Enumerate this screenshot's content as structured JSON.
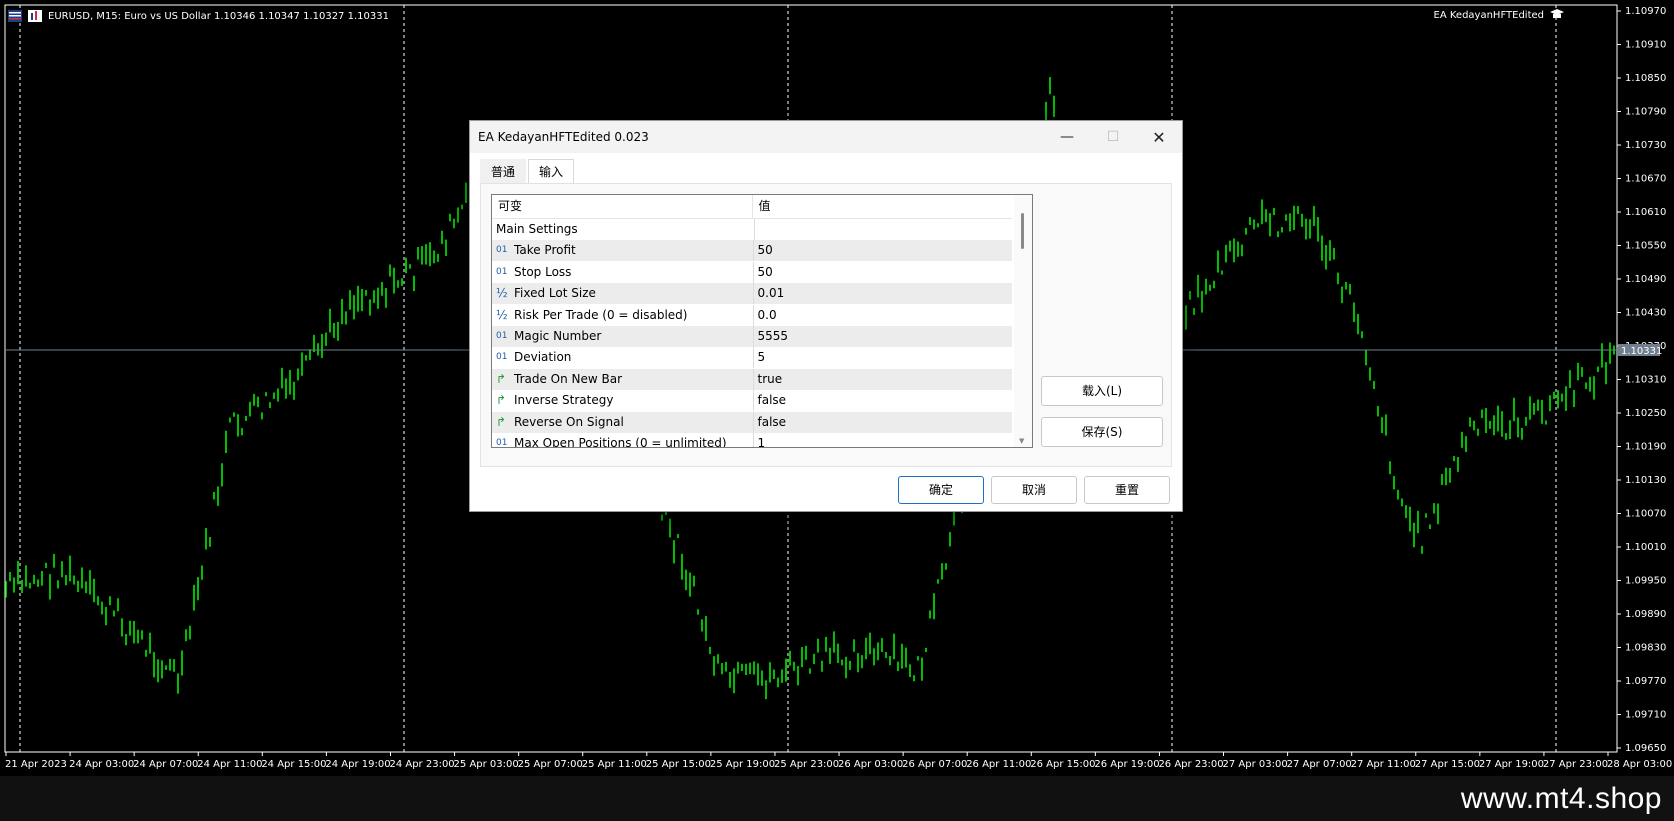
{
  "chart": {
    "symbol_line": "EURUSD, M15:  Euro vs US Dollar  1.10346 1.10347 1.10327 1.10331",
    "ea_name": "EA KedayanHFTEdited",
    "current_price": "1.10331",
    "colors": {
      "candles": "#00ff00",
      "background": "#000000",
      "price_line": "#6f7f8f",
      "price_label_bg": "#6f7f8f"
    },
    "price_ticks": [
      "1.10970",
      "1.10910",
      "1.10850",
      "1.10790",
      "1.10730",
      "1.10670",
      "1.10610",
      "1.10550",
      "1.10490",
      "1.10430",
      "1.10370",
      "1.10310",
      "1.10250",
      "1.10190",
      "1.10130",
      "1.10070",
      "1.10010",
      "1.09950",
      "1.09890",
      "1.09830",
      "1.09770",
      "1.09710",
      "1.09650"
    ],
    "time_ticks": [
      "21 Apr 2023",
      "24 Apr 03:00",
      "24 Apr 07:00",
      "24 Apr 11:00",
      "24 Apr 15:00",
      "24 Apr 19:00",
      "24 Apr 23:00",
      "25 Apr 03:00",
      "25 Apr 07:00",
      "25 Apr 11:00",
      "25 Apr 15:00",
      "25 Apr 19:00",
      "25 Apr 23:00",
      "26 Apr 03:00",
      "26 Apr 07:00",
      "26 Apr 11:00",
      "26 Apr 15:00",
      "26 Apr 19:00",
      "26 Apr 23:00",
      "27 Apr 03:00",
      "27 Apr 07:00",
      "27 Apr 11:00",
      "27 Apr 15:00",
      "27 Apr 19:00",
      "27 Apr 23:00",
      "28 Apr 03:00"
    ]
  },
  "dialog": {
    "title": "EA KedayanHFTEdited 0.023",
    "tabs": [
      {
        "label": "普通"
      },
      {
        "label": "输入"
      }
    ],
    "columns": {
      "name": "可变",
      "value": "值"
    },
    "rows": [
      {
        "icon": "",
        "name": "Main Settings",
        "value": ""
      },
      {
        "icon": "01",
        "name": "Take Profit",
        "value": "50"
      },
      {
        "icon": "01",
        "name": "Stop Loss",
        "value": "50"
      },
      {
        "icon": "½",
        "name": "Fixed Lot Size",
        "value": "0.01"
      },
      {
        "icon": "½",
        "name": "Risk Per Trade (0 = disabled)",
        "value": "0.0"
      },
      {
        "icon": "01",
        "name": "Magic Number",
        "value": "5555"
      },
      {
        "icon": "01",
        "name": "Deviation",
        "value": "5"
      },
      {
        "icon": "bool",
        "name": "Trade On New Bar",
        "value": "true"
      },
      {
        "icon": "bool",
        "name": "Inverse Strategy",
        "value": "false"
      },
      {
        "icon": "bool",
        "name": "Reverse On Signal",
        "value": "false"
      },
      {
        "icon": "01",
        "name": "Max Open Positions (0 = unlimited)",
        "value": "1"
      }
    ],
    "side_buttons": {
      "load": "载入(L)",
      "save": "保存(S)"
    },
    "footer": {
      "ok": "确定",
      "cancel": "取消",
      "reset": "重置"
    }
  },
  "watermark": "www.mt4.shop"
}
